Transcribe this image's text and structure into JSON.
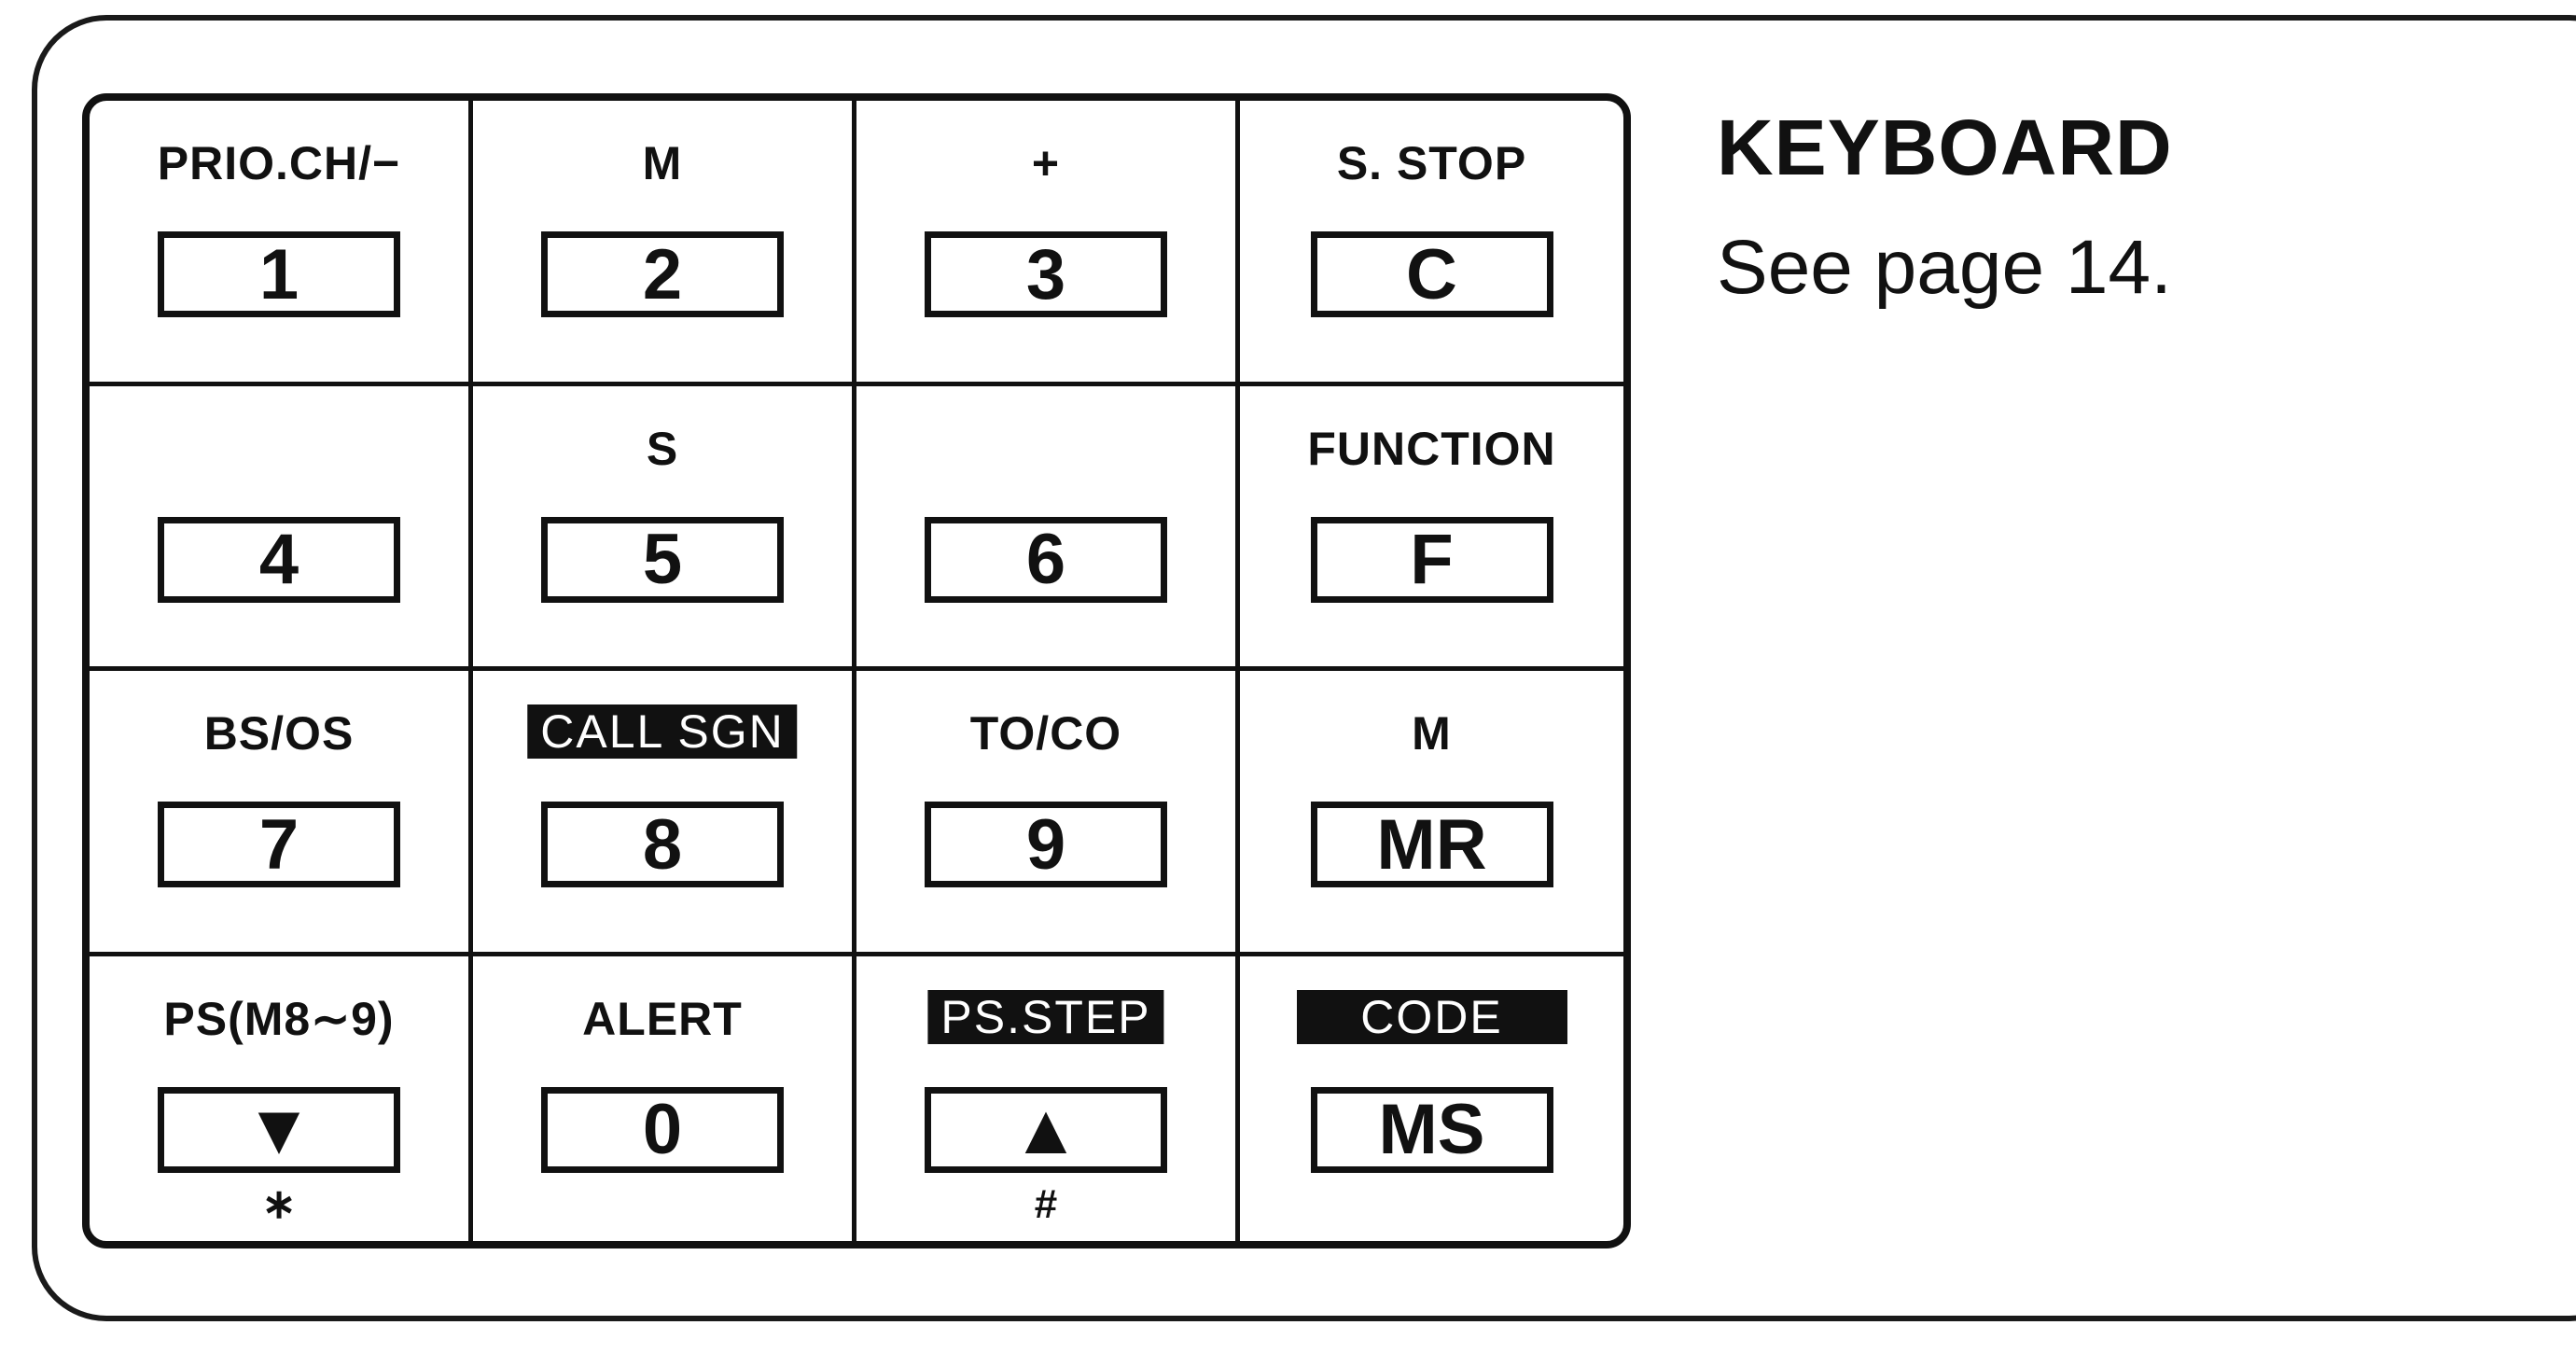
{
  "title": "KEYBOARD",
  "note": "See page 14.",
  "keys": [
    {
      "fn": "PRIO.CH/−",
      "key": "1",
      "sub": ""
    },
    {
      "fn": "M",
      "key": "2",
      "sub": ""
    },
    {
      "fn": "+",
      "key": "3",
      "sub": ""
    },
    {
      "fn": "S. STOP",
      "key": "C",
      "sub": ""
    },
    {
      "fn": "",
      "key": "4",
      "sub": ""
    },
    {
      "fn": "S",
      "key": "5",
      "sub": ""
    },
    {
      "fn": "",
      "key": "6",
      "sub": ""
    },
    {
      "fn": "FUNCTION",
      "key": "F",
      "sub": ""
    },
    {
      "fn": "BS/OS",
      "key": "7",
      "sub": ""
    },
    {
      "fn": "CALL SGN",
      "key": "8",
      "sub": ""
    },
    {
      "fn": "TO/CO",
      "key": "9",
      "sub": ""
    },
    {
      "fn": "M",
      "key": "MR",
      "sub": ""
    },
    {
      "fn": "PS(M8∼9)",
      "key": "▼",
      "sub": "∗"
    },
    {
      "fn": "ALERT",
      "key": "0",
      "sub": ""
    },
    {
      "fn": "PS.STEP",
      "key": "▲",
      "sub": "#"
    },
    {
      "fn": "CODE",
      "key": "MS",
      "sub": ""
    }
  ]
}
